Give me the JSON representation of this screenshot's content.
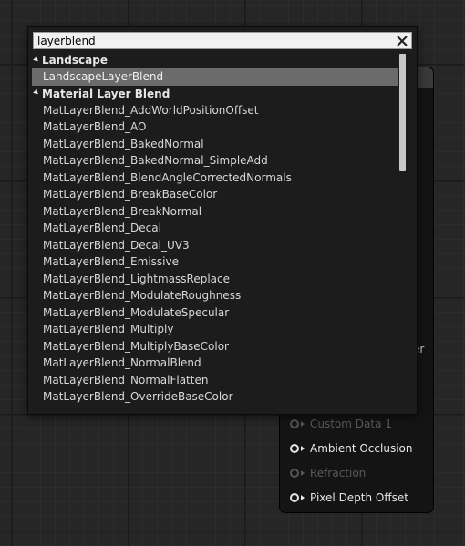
{
  "node": {
    "peek_a": "t",
    "peek_b": "er",
    "pins": [
      {
        "label": "Custom Data 1",
        "enabled": false
      },
      {
        "label": "Ambient Occlusion",
        "enabled": true
      },
      {
        "label": "Refraction",
        "enabled": false
      },
      {
        "label": "Pixel Depth Offset",
        "enabled": true
      }
    ]
  },
  "menu": {
    "search_value": "layerblend",
    "categories": [
      {
        "name": "Landscape",
        "items": [
          "LandscapeLayerBlend"
        ]
      },
      {
        "name": "Material Layer Blend",
        "items": [
          "MatLayerBlend_AddWorldPositionOffset",
          "MatLayerBlend_AO",
          "MatLayerBlend_BakedNormal",
          "MatLayerBlend_BakedNormal_SimpleAdd",
          "MatLayerBlend_BlendAngleCorrectedNormals",
          "MatLayerBlend_BreakBaseColor",
          "MatLayerBlend_BreakNormal",
          "MatLayerBlend_Decal",
          "MatLayerBlend_Decal_UV3",
          "MatLayerBlend_Emissive",
          "MatLayerBlend_LightmassReplace",
          "MatLayerBlend_ModulateRoughness",
          "MatLayerBlend_ModulateSpecular",
          "MatLayerBlend_Multiply",
          "MatLayerBlend_MultiplyBaseColor",
          "MatLayerBlend_NormalBlend",
          "MatLayerBlend_NormalFlatten",
          "MatLayerBlend_OverrideBaseColor"
        ]
      }
    ],
    "selected_item": "LandscapeLayerBlend",
    "scroll_fraction_visible": 0.33
  }
}
